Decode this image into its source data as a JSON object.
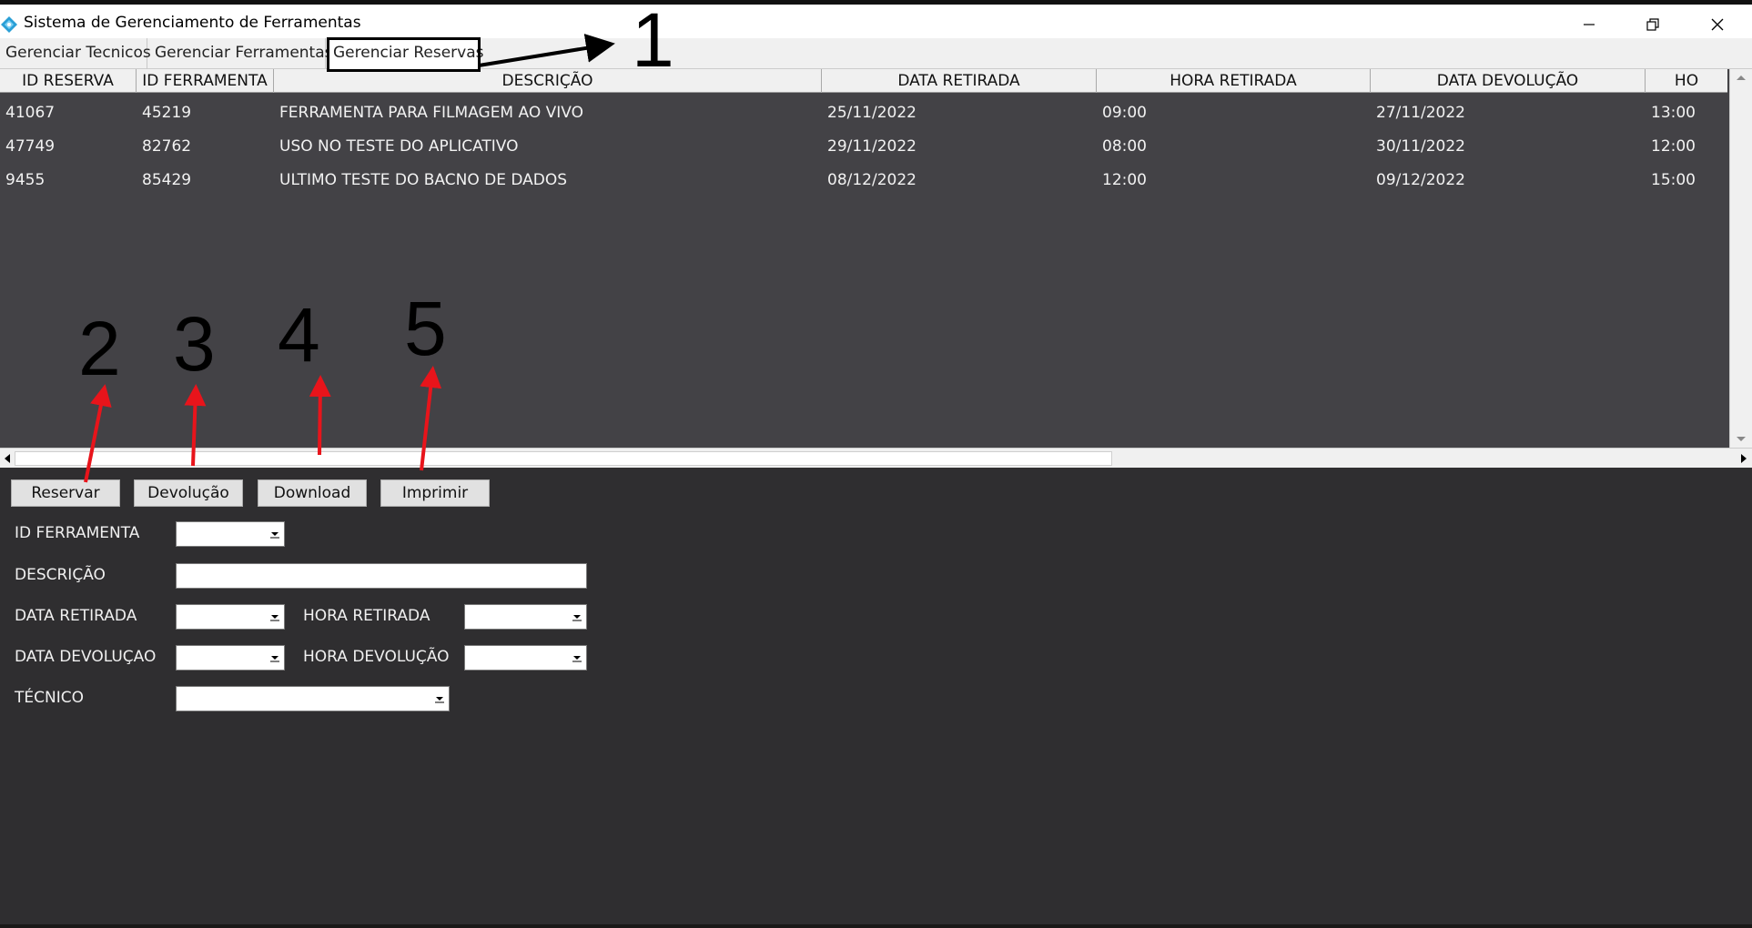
{
  "window": {
    "title": "Sistema de Gerenciamento de Ferramentas"
  },
  "tabs": [
    {
      "label": "Gerenciar Tecnicos"
    },
    {
      "label": "Gerenciar Ferramentas"
    },
    {
      "label": "Gerenciar Reservas"
    }
  ],
  "grid": {
    "columns": [
      "ID RESERVA",
      "ID FERRAMENTA",
      "DESCRIÇÃO",
      "DATA RETIRADA",
      "HORA RETIRADA",
      "DATA DEVOLUÇÃO",
      "HO"
    ],
    "rows": [
      [
        "41067",
        "45219",
        "FERRAMENTA PARA FILMAGEM AO VIVO",
        "25/11/2022",
        "09:00",
        "27/11/2022",
        "13:00"
      ],
      [
        "47749",
        "82762",
        "USO NO TESTE DO APLICATIVO",
        "29/11/2022",
        "08:00",
        "30/11/2022",
        "12:00"
      ],
      [
        "9455",
        "85429",
        "ULTIMO TESTE DO BACNO DE DADOS",
        "08/12/2022",
        "12:00",
        "09/12/2022",
        "15:00"
      ]
    ]
  },
  "buttons": {
    "reservar": "Reservar",
    "devolucao": "Devolução",
    "download": "Download",
    "imprimir": "Imprimir"
  },
  "form": {
    "id_ferramenta_label": "ID FERRAMENTA",
    "descricao_label": "DESCRIÇÃO",
    "data_retirada_label": "DATA RETIRADA",
    "hora_retirada_label": "HORA RETIRADA",
    "data_devolucao_label": "DATA DEVOLUÇAO",
    "hora_devolucao_label": "HORA DEVOLUÇÃO",
    "tecnico_label": "TÉCNICO"
  },
  "annotations": [
    "1",
    "2",
    "3",
    "4",
    "5"
  ]
}
